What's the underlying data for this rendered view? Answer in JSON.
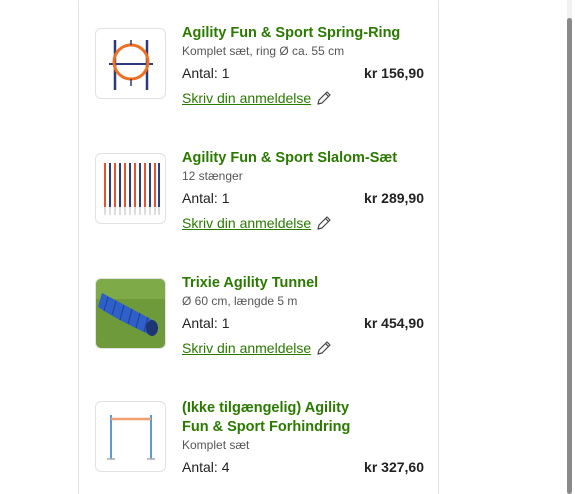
{
  "items": [
    {
      "title": "Agility Fun & Sport Spring-Ring",
      "subtitle": "Komplet sæt, ring Ø ca. 55 cm",
      "quantity": "Antal: 1",
      "price": "kr 156,90",
      "review": "Skriv din anmeldelse",
      "image": "spring-ring-image"
    },
    {
      "title": "Agility Fun & Sport Slalom-Sæt",
      "subtitle": "12 stænger",
      "quantity": "Antal: 1",
      "price": "kr 289,90",
      "review": "Skriv din anmeldelse",
      "image": "slalom-poles-image"
    },
    {
      "title": "Trixie Agility Tunnel",
      "subtitle": "Ø 60 cm, længde 5 m",
      "quantity": "Antal: 1",
      "price": "kr 454,90",
      "review": "Skriv din anmeldelse",
      "image": "agility-tunnel-image"
    },
    {
      "title": "(Ikke tilgængelig) Agility Fun & Sport Forhindring",
      "subtitle": "Komplet sæt",
      "quantity": "Antal: 4",
      "price": "kr 327,60",
      "image": "hurdle-image"
    }
  ],
  "colors": {
    "title": "#2a7a00",
    "link": "#2a7a00"
  },
  "icons": {
    "review": "pencil-icon"
  }
}
